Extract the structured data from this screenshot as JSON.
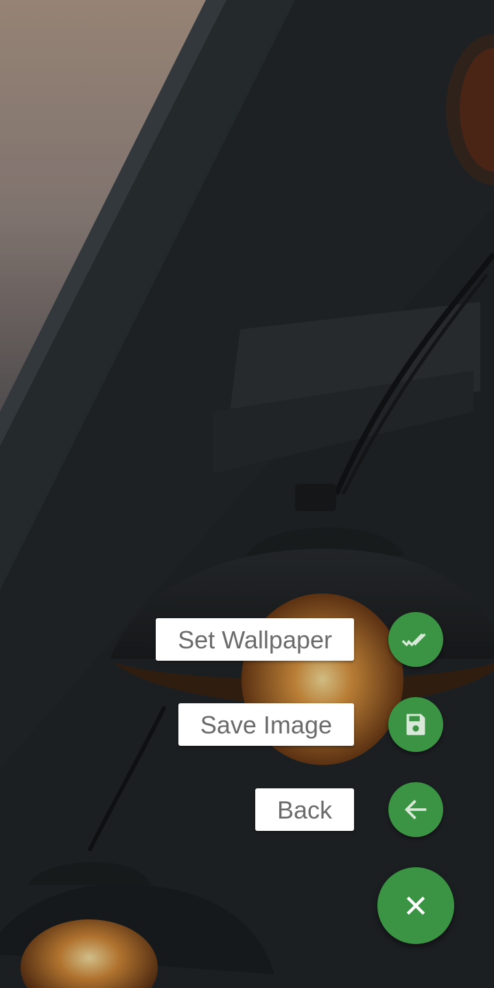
{
  "accent_color": "#3b9444",
  "fab_menu": {
    "items": [
      {
        "label": "Set Wallpaper",
        "icon": "double-check-icon"
      },
      {
        "label": "Save Image",
        "icon": "save-icon"
      },
      {
        "label": "Back",
        "icon": "arrow-back-icon"
      }
    ],
    "main_fab_icon": "close-icon"
  }
}
